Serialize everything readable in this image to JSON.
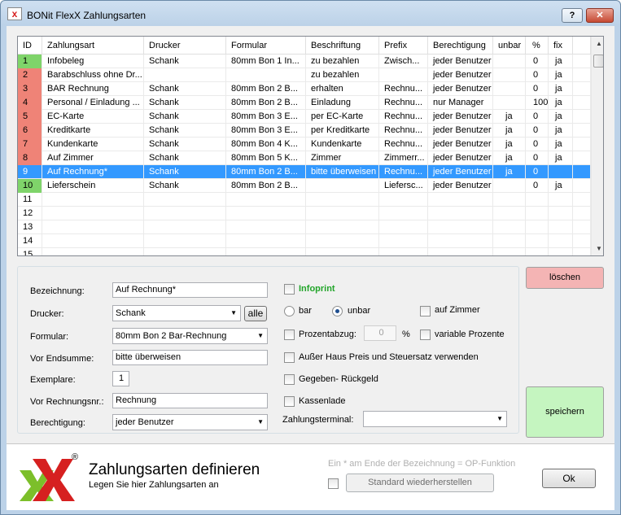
{
  "window": {
    "title": "BONit FlexX Zahlungsarten",
    "help_label": "?",
    "close_label": "✕"
  },
  "grid": {
    "columns": [
      "ID",
      "Zahlungsart",
      "Drucker",
      "Formular",
      "Beschriftung",
      "Prefix",
      "Berechtigung",
      "unbar",
      "%",
      "fix"
    ],
    "rows": [
      {
        "id": "1",
        "name": "Infobeleg",
        "drucker": "Schank",
        "formular": "80mm Bon 1   In...",
        "beschriftung": "zu bezahlen",
        "prefix": "Zwisch...",
        "berechtigung": "jeder Benutzer",
        "unbar": "",
        "pct": "0",
        "fix": "ja",
        "color": "green"
      },
      {
        "id": "2",
        "name": "Barabschluss ohne Dr...",
        "drucker": "",
        "formular": "",
        "beschriftung": "zu bezahlen",
        "prefix": "",
        "berechtigung": "jeder Benutzer",
        "unbar": "",
        "pct": "0",
        "fix": "ja",
        "color": "red"
      },
      {
        "id": "3",
        "name": "BAR Rechnung",
        "drucker": "Schank",
        "formular": "80mm Bon 2   B...",
        "beschriftung": "erhalten",
        "prefix": "Rechnu...",
        "berechtigung": "jeder Benutzer",
        "unbar": "",
        "pct": "0",
        "fix": "ja",
        "color": "red"
      },
      {
        "id": "4",
        "name": "Personal / Einladung ...",
        "drucker": "Schank",
        "formular": "80mm Bon 2   B...",
        "beschriftung": "Einladung",
        "prefix": "Rechnu...",
        "berechtigung": "nur Manager",
        "unbar": "",
        "pct": "100",
        "fix": "ja",
        "color": "red"
      },
      {
        "id": "5",
        "name": "EC-Karte",
        "drucker": "Schank",
        "formular": "80mm Bon 3   E...",
        "beschriftung": "per EC-Karte",
        "prefix": "Rechnu...",
        "berechtigung": "jeder Benutzer",
        "unbar": "ja",
        "pct": "0",
        "fix": "ja",
        "color": "red"
      },
      {
        "id": "6",
        "name": "Kreditkarte",
        "drucker": "Schank",
        "formular": "80mm Bon 3   E...",
        "beschriftung": "per Kreditkarte",
        "prefix": "Rechnu...",
        "berechtigung": "jeder Benutzer",
        "unbar": "ja",
        "pct": "0",
        "fix": "ja",
        "color": "red"
      },
      {
        "id": "7",
        "name": "Kundenkarte",
        "drucker": "Schank",
        "formular": "80mm Bon 4   K...",
        "beschriftung": "Kundenkarte",
        "prefix": "Rechnu...",
        "berechtigung": "jeder Benutzer",
        "unbar": "ja",
        "pct": "0",
        "fix": "ja",
        "color": "red"
      },
      {
        "id": "8",
        "name": "Auf Zimmer",
        "drucker": "Schank",
        "formular": "80mm Bon 5   K...",
        "beschriftung": "Zimmer",
        "prefix": "Zimmerr...",
        "berechtigung": "jeder Benutzer",
        "unbar": "ja",
        "pct": "0",
        "fix": "ja",
        "color": "red"
      },
      {
        "id": "9",
        "name": "Auf Rechnung*",
        "drucker": "Schank",
        "formular": "80mm Bon 2   B...",
        "beschriftung": "bitte überweisen",
        "prefix": "Rechnu...",
        "berechtigung": "jeder Benutzer",
        "unbar": "ja",
        "pct": "0",
        "fix": "",
        "color": "selected"
      },
      {
        "id": "10",
        "name": "Lieferschein",
        "drucker": "Schank",
        "formular": "80mm Bon 2   B...",
        "beschriftung": "",
        "prefix": "Liefersc...",
        "berechtigung": "jeder Benutzer",
        "unbar": "",
        "pct": "0",
        "fix": "ja",
        "color": "green"
      },
      {
        "id": "11",
        "name": "",
        "drucker": "",
        "formular": "",
        "beschriftung": "",
        "prefix": "",
        "berechtigung": "",
        "unbar": "",
        "pct": "",
        "fix": "",
        "color": ""
      },
      {
        "id": "12",
        "name": "",
        "drucker": "",
        "formular": "",
        "beschriftung": "",
        "prefix": "",
        "berechtigung": "",
        "unbar": "",
        "pct": "",
        "fix": "",
        "color": ""
      },
      {
        "id": "13",
        "name": "",
        "drucker": "",
        "formular": "",
        "beschriftung": "",
        "prefix": "",
        "berechtigung": "",
        "unbar": "",
        "pct": "",
        "fix": "",
        "color": ""
      },
      {
        "id": "14",
        "name": "",
        "drucker": "",
        "formular": "",
        "beschriftung": "",
        "prefix": "",
        "berechtigung": "",
        "unbar": "",
        "pct": "",
        "fix": "",
        "color": ""
      },
      {
        "id": "15",
        "name": "",
        "drucker": "",
        "formular": "",
        "beschriftung": "",
        "prefix": "",
        "berechtigung": "",
        "unbar": "",
        "pct": "",
        "fix": "",
        "color": ""
      }
    ]
  },
  "form": {
    "bezeichnung_label": "Bezeichnung:",
    "bezeichnung_value": "Auf Rechnung*",
    "drucker_label": "Drucker:",
    "drucker_value": "Schank",
    "alle_label": "alle",
    "formular_label": "Formular:",
    "formular_value": "80mm Bon 2  Bar-Rechnung",
    "vor_endsumme_label": "Vor Endsumme:",
    "vor_endsumme_value": "bitte überweisen",
    "exemplare_label": "Exemplare:",
    "exemplare_value": "1",
    "vor_rechnungsnr_label": "Vor Rechnungsnr.:",
    "vor_rechnungsnr_value": "Rechnung",
    "berechtigung_label": "Berechtigung:",
    "berechtigung_value": "jeder Benutzer",
    "infoprint_label": "Infoprint",
    "bar_label": "bar",
    "unbar_label": "unbar",
    "auf_zimmer_label": "auf Zimmer",
    "prozentabzug_label": "Prozentabzug:",
    "prozentabzug_value": "0",
    "pct_sign": "%",
    "variable_prozente_label": "variable Prozente",
    "ausser_haus_label": "Außer Haus Preis und Steuersatz verwenden",
    "rueckgeld_label": "Gegeben- Rückgeld",
    "kassenlade_label": "Kassenlade",
    "zahlungsterminal_label": "Zahlungsterminal:",
    "zahlungsterminal_value": ""
  },
  "actions": {
    "loeschen_label": "löschen",
    "speichern_label": "speichern",
    "ok_label": "Ok",
    "standard_label": "Standard wiederherstellen"
  },
  "footer": {
    "heading": "Zahlungsarten definieren",
    "subheading": "Legen Sie hier Zahlungsarten an",
    "hint": "Ein * am Ende der Bezeichnung = OP-Funktion",
    "logo_registered": "®"
  },
  "colors": {
    "red": "#ef8377",
    "green": "#7fd46a",
    "selected": "#3399ff",
    "infoprint": "#22a52a",
    "loeschen_bg": "#f4b4b4",
    "speichern_bg": "#c5f5c0"
  }
}
